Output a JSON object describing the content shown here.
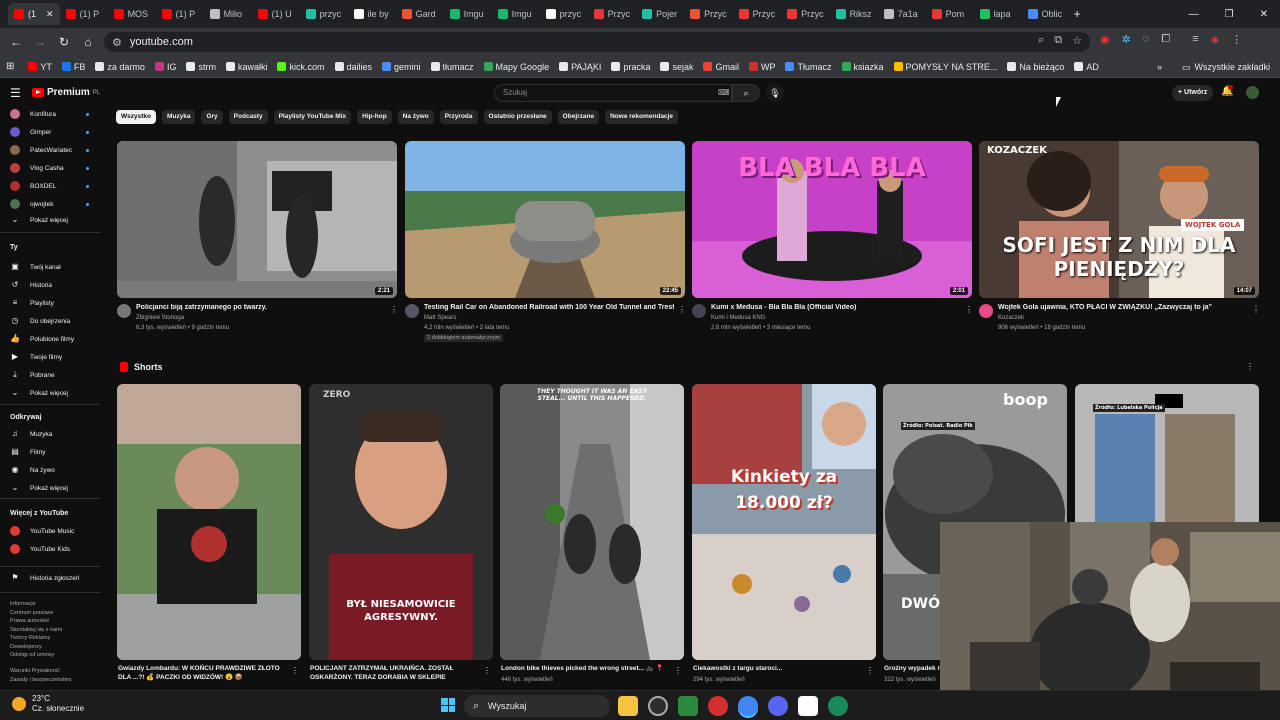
{
  "browser": {
    "tabs": [
      {
        "label": "(1",
        "color": "#ff0000"
      },
      {
        "label": "(1) P",
        "color": "#ff0000"
      },
      {
        "label": "MOS",
        "color": "#ff0000"
      },
      {
        "label": "(1) P",
        "color": "#ff0000"
      },
      {
        "label": "Milio",
        "color": "#bdc1c6"
      },
      {
        "label": "(1) U",
        "color": "#ff0000"
      },
      {
        "label": "przyc",
        "color": "#20c0a0"
      },
      {
        "label": "ile by",
        "color": "#ffffff"
      },
      {
        "label": "Gard",
        "color": "#e8552f"
      },
      {
        "label": "Imgu",
        "color": "#1bb76e"
      },
      {
        "label": "Imgu",
        "color": "#1bb76e"
      },
      {
        "label": "przyc",
        "color": "#ffffff"
      },
      {
        "label": "Przyc",
        "color": "#e53935"
      },
      {
        "label": "Pojer",
        "color": "#20c0a0"
      },
      {
        "label": "Przyc",
        "color": "#e8552f"
      },
      {
        "label": "Przyc",
        "color": "#e53935"
      },
      {
        "label": "Przyc",
        "color": "#e53935"
      },
      {
        "label": "Riksz",
        "color": "#20c0a0"
      },
      {
        "label": "7a1a",
        "color": "#bdc1c6"
      },
      {
        "label": "Pom",
        "color": "#e53935"
      },
      {
        "label": "lapa",
        "color": "#20c060"
      },
      {
        "label": "Oblic",
        "color": "#4c8bf5"
      }
    ],
    "new_tab": "+",
    "window_controls": {
      "minimize": "—",
      "restore": "❐",
      "close": "✕"
    },
    "url": "youtube.com",
    "bookmarks": [
      {
        "label": "YT",
        "color": "#ff0000"
      },
      {
        "label": "FB",
        "color": "#1877f2"
      },
      {
        "label": "za darmo",
        "color": "#e8eaed"
      },
      {
        "label": "IG",
        "color": "#c13584"
      },
      {
        "label": "strm",
        "color": "#e8eaed"
      },
      {
        "label": "kawałki",
        "color": "#e8eaed"
      },
      {
        "label": "kick.com",
        "color": "#53fc18"
      },
      {
        "label": "dailies",
        "color": "#e8eaed"
      },
      {
        "label": "gemini",
        "color": "#4c8bf5"
      },
      {
        "label": "tłumacz",
        "color": "#e8eaed"
      },
      {
        "label": "Mapy Google",
        "color": "#34a853"
      },
      {
        "label": "PAJĄKI",
        "color": "#e8eaed"
      },
      {
        "label": "pracka",
        "color": "#e8eaed"
      },
      {
        "label": "sejak",
        "color": "#e8eaed"
      },
      {
        "label": "Gmail",
        "color": "#ea4335"
      },
      {
        "label": "WP",
        "color": "#d32f2f"
      },
      {
        "label": "Tłumacz",
        "color": "#4c8bf5"
      },
      {
        "label": "ksiazka",
        "color": "#34a853"
      },
      {
        "label": "POMYSŁY NA STRE...",
        "color": "#fbbc04"
      },
      {
        "label": "Na bieżąco",
        "color": "#e8eaed"
      },
      {
        "label": "AD",
        "color": "#e8eaed"
      }
    ],
    "all_bookmarks": "Wszystkie zakładki"
  },
  "youtube": {
    "logo": "Premium",
    "logo_sup": "PL",
    "search_placeholder": "Szukaj",
    "create_label": "Utwórz",
    "chips": [
      "Wszystko",
      "Muzyka",
      "Gry",
      "Podcasty",
      "Playlisty YouTube Mix",
      "Hip-hop",
      "Na żywo",
      "Przyroda",
      "Ostatnio przesłane",
      "Obejrzane",
      "Nowe rekomendacje"
    ],
    "sidebar": {
      "subscriptions": [
        {
          "label": "Konfitura",
          "color": "#d07090"
        },
        {
          "label": "Gimper",
          "color": "#6a5acd"
        },
        {
          "label": "PatecWariatec",
          "color": "#8a6a4a"
        },
        {
          "label": "Vlog Casha",
          "color": "#c04040"
        },
        {
          "label": "BOXDEL",
          "color": "#b03030"
        },
        {
          "label": "ojwojtek",
          "color": "#507050"
        }
      ],
      "show_more_1": "Pokaż więcej",
      "you_heading": "Ty",
      "you_items": [
        "Twój kanał",
        "Historia",
        "Playlisty",
        "Do obejrzenia",
        "Polubione filmy",
        "Twoje filmy",
        "Pobrane",
        "Pokaż więcej"
      ],
      "explore_heading": "Odkrywaj",
      "explore_items": [
        "Muzyka",
        "Filmy",
        "Na żywo",
        "Pokaż więcej"
      ],
      "more_heading": "Więcej z YouTube",
      "more_items": [
        "YouTube Music",
        "YouTube Kids"
      ],
      "report_history": "Historia zgłoszeń",
      "footer_1": "Informacje",
      "footer_2": "Centrum prasowe",
      "footer_3": "Prawa autorskie",
      "footer_4": "Skontaktuj się z nami",
      "footer_5": "Twórcy  Reklamy",
      "footer_6": "Deweloperzy",
      "footer_7": "Odstąp od umowy",
      "footer_8": "Warunki  Prywatność",
      "footer_9": "Zasady i bezpieczeństwo"
    },
    "videos": [
      {
        "title": "Policjanci biją zatrzymanego po twarzy.",
        "channel": "Zbigniew Stonoga",
        "stats": "6,3 tys. wyświetleń • 9 godzin temu",
        "duration": "2:21"
      },
      {
        "title": "Testing Rail Car on Abandoned Railroad with 100 Year Old Tunnel and Trestles",
        "channel": "Matt Spears",
        "stats": "4,2 mln wyświetleń • 2 lata temu",
        "duration": "22:45",
        "badge": "2 dubbingiem automatycznym"
      },
      {
        "title": "Kumi x Medusa - Bla Bla Bla (Official Video)",
        "channel": "Kumi i Medusa KNG",
        "stats": "2,6 mln wyświetleń • 3 miesiące temu",
        "duration": "2:01"
      },
      {
        "title": "Wojtek Gola ujawnia, KTO PŁACI W ZWIĄZKU! „Zazwyczaj to ja”",
        "channel": "Kozaczek",
        "stats": "906 wyświetleń • 18 godzin temu",
        "duration": "14:07"
      }
    ],
    "thumb_texts": {
      "blablabla": "BLA BLA BLA",
      "kozaczek": "KOZACZEK",
      "wojtek_tag": "WOJTEK GOLA",
      "sofi": "SOFI JEST Z NIM DLA PIENIĘDZY?"
    },
    "shorts_heading": "Shorts",
    "shorts": [
      {
        "title": "Gwiazdy Lombardu: W KOŃCU PRAWDZIWE ZŁOTO DLA ...?! 💰 PACZKI OD WIDZÓW! 😮 📦",
        "views": ""
      },
      {
        "title": "POLICJANT ZATRZYMAŁ UKRAIŃCA. ZOSTAŁ OSKARŻONY. TERAZ DORABIA W SKLEPIE",
        "views": "",
        "overlay": "BYŁ NIESAMOWICIE AGRESYWNY.",
        "brand": "ZERO"
      },
      {
        "title": "London bike thieves picked the wrong street... 🚲 📍",
        "views": "446 tys. wyświetleń",
        "overlay": "THEY THOUGHT IT WAS AN EASY STEAL... UNTIL THIS HAPPENED."
      },
      {
        "title": "Ciekawostki z targu staroci...",
        "views": "294 tys. wyświetleń",
        "overlay": "Kinkiety za 18.000 zł?"
      },
      {
        "title": "Groźny wypadek n",
        "views": "322 tys. wyświetleń",
        "overlay": "DWÓ",
        "brand": "boop",
        "caption": "Źródło: Polsat. Radio Pik"
      },
      {
        "title": "",
        "views": "",
        "caption": "Źródło: Lubelska Policja"
      }
    ]
  },
  "taskbar": {
    "temp": "23°C",
    "weather": "Cz. słonecznie",
    "search": "Wyszukaj"
  }
}
